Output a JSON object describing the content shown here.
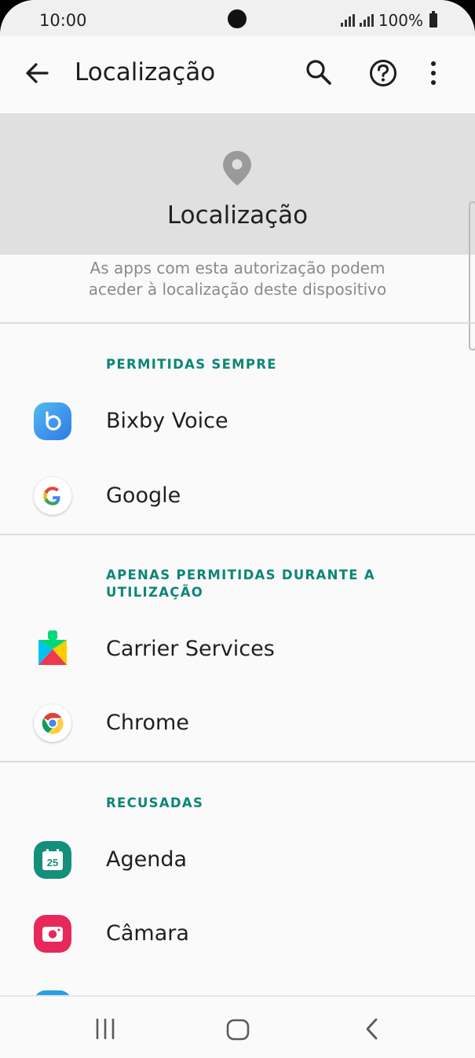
{
  "status_bar": {
    "time": "10:00",
    "battery": "100%"
  },
  "app_bar": {
    "title": "Localização"
  },
  "header": {
    "title": "Localização",
    "description_line1": "As apps com esta autorização podem",
    "description_line2": "aceder à localização deste dispositivo"
  },
  "sections": [
    {
      "label": "PERMITIDAS SEMPRE",
      "apps": [
        {
          "name": "Bixby Voice",
          "icon": "bixby-voice-icon"
        },
        {
          "name": "Google",
          "icon": "google-icon"
        }
      ]
    },
    {
      "label": "APENAS PERMITIDAS DURANTE A UTILIZAÇÃO",
      "apps": [
        {
          "name": "Carrier Services",
          "icon": "carrier-services-icon"
        },
        {
          "name": "Chrome",
          "icon": "chrome-icon"
        }
      ]
    },
    {
      "label": "RECUSADAS",
      "apps": [
        {
          "name": "Agenda",
          "icon": "calendar-icon",
          "badge": "25"
        },
        {
          "name": "Câmara",
          "icon": "camera-icon"
        }
      ]
    }
  ],
  "colors": {
    "accent": "#0d8577",
    "header_bg": "#e0e0e0",
    "background": "#fafafa"
  }
}
